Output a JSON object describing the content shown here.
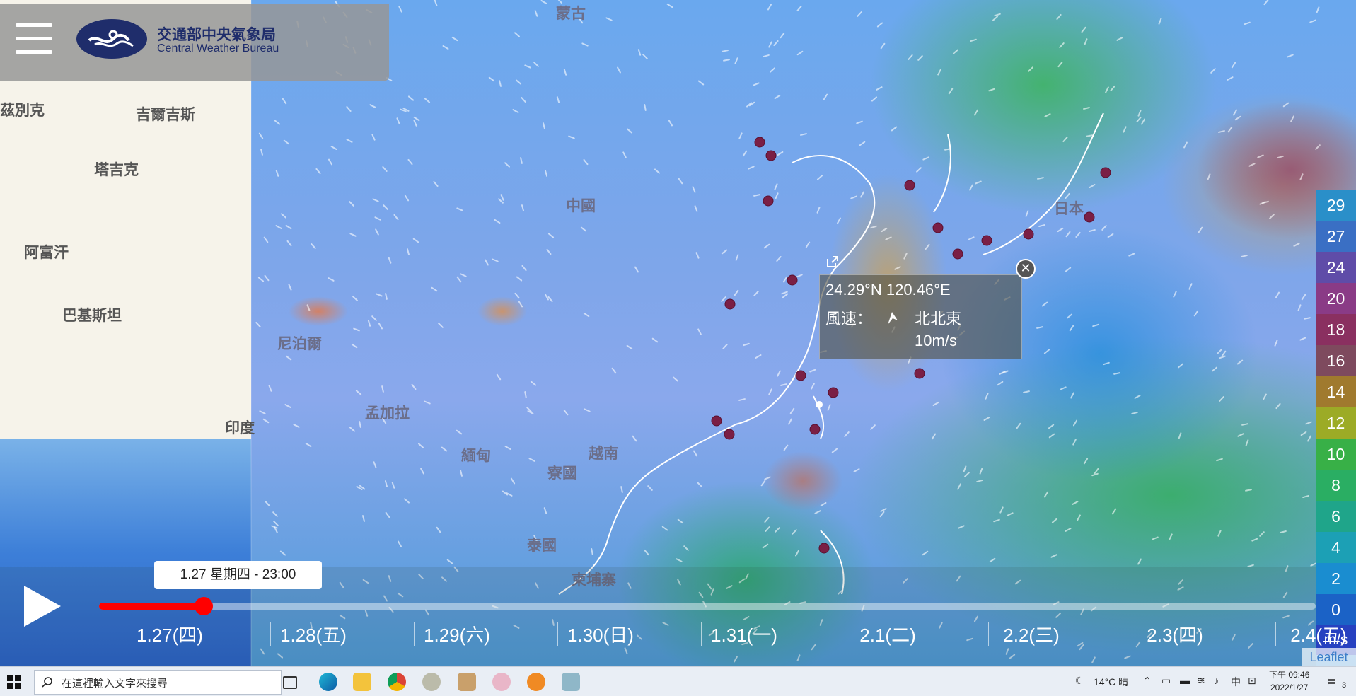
{
  "header": {
    "title_zh": "交通部中央氣象局",
    "title_en": "Central Weather Bureau"
  },
  "places": [
    {
      "name": "茲別克"
    },
    {
      "name": "吉爾吉斯"
    },
    {
      "name": "塔吉克"
    },
    {
      "name": "阿富汗"
    },
    {
      "name": "巴基斯坦"
    },
    {
      "name": "印度"
    },
    {
      "name": "尼泊爾"
    },
    {
      "name": "孟加拉"
    },
    {
      "name": "緬甸"
    },
    {
      "name": "寮國"
    },
    {
      "name": "越南"
    },
    {
      "name": "泰國"
    },
    {
      "name": "柬埔寨"
    },
    {
      "name": "中國"
    },
    {
      "name": "日本"
    },
    {
      "name": "蒙古"
    }
  ],
  "popup": {
    "coords": "24.29°N  120.46°E",
    "wind_label": "風速：",
    "direction": "北北東",
    "speed": "10m/s",
    "close_symbol": "✕"
  },
  "legend": {
    "values": [
      "29",
      "27",
      "24",
      "20",
      "18",
      "16",
      "14",
      "12",
      "10",
      "8",
      "6",
      "4",
      "2",
      "0"
    ],
    "colors": [
      "#2a8fc9",
      "#3a6fc4",
      "#5f4ca8",
      "#8a3b86",
      "#8a3060",
      "#7e4a5e",
      "#a07a2e",
      "#9cab26",
      "#38b047",
      "#2aae63",
      "#1fa58a",
      "#1ca0b5",
      "#1a8dd0",
      "#1b62c6"
    ],
    "unit": "m/s"
  },
  "timeline": {
    "current_time": "1.27 星期四 - 23:00",
    "progress": 0.086,
    "days": [
      "1.27(四)",
      "1.28(五)",
      "1.29(六)",
      "1.30(日)",
      "1.31(一)",
      "2.1(二)",
      "2.2(三)",
      "2.3(四)",
      "2.4(五)"
    ]
  },
  "attribution": "Leaflet",
  "taskbar": {
    "search_placeholder": "在這裡輸入文字來搜尋",
    "weather": "14°C  晴",
    "ime": "中",
    "time": "下午 09:46",
    "date": "2022/1/27",
    "notification_count": "3"
  }
}
